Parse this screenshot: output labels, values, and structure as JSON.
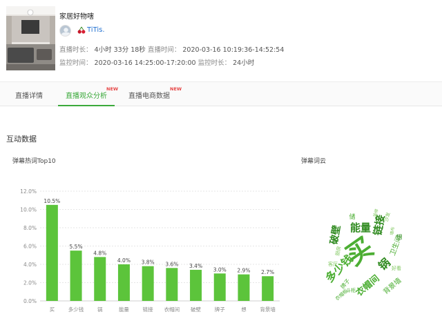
{
  "header": {
    "title": "家居好物嗐",
    "anchor_name": "TiTis.",
    "row1": {
      "duration_label": "直播时长：",
      "duration_value": "4小时 33分 18秒",
      "time_label": "直播时间：",
      "time_value": "2020-03-16 10:19:36-14:52:54"
    },
    "row2": {
      "monitor_time_label": "监控时间：",
      "monitor_time_value": "2020-03-16 14:25:00-17:20:00",
      "monitor_duration_label": "监控时长：",
      "monitor_duration_value": "24小时"
    }
  },
  "tabs": [
    {
      "label": "直播详情",
      "active": false,
      "new": ""
    },
    {
      "label": "直播观众分析",
      "active": true,
      "new": "NEW"
    },
    {
      "label": "直播电商数据",
      "active": false,
      "new": "NEW"
    }
  ],
  "section_title": "互动数据",
  "bar_chart_title": "弹幕热词Top10",
  "cloud_title": "弹幕词云",
  "colors": {
    "accent": "#3aa93a",
    "bar": "#5cc43b",
    "new_badge": "#e64545",
    "cloud_dark": "#2f8a1f",
    "cloud_mid": "#4cae33",
    "cloud_light": "#7cc65a"
  },
  "chart_data": {
    "type": "bar",
    "title": "弹幕热词Top10",
    "categories": [
      "买",
      "多少钱",
      "锅",
      "能量",
      "链接",
      "衣帽间",
      "破壁",
      "牌子",
      "想",
      "背景墙"
    ],
    "values": [
      10.5,
      5.5,
      4.8,
      4.0,
      3.8,
      3.6,
      3.4,
      3.0,
      2.9,
      2.7
    ],
    "value_labels": [
      "10.5%",
      "5.5%",
      "4.8%",
      "4.0%",
      "3.8%",
      "3.6%",
      "3.4%",
      "3.0%",
      "2.9%",
      "2.7%"
    ],
    "y_ticks": [
      "0.0%",
      "2.0%",
      "4.0%",
      "6.0%",
      "8.0%",
      "10.0%",
      "12.0%"
    ],
    "ylim": [
      0,
      12
    ],
    "grid": true,
    "xlabel": "",
    "ylabel": ""
  },
  "word_cloud": [
    {
      "text": "买",
      "weight": 10
    },
    {
      "text": "多少钱",
      "weight": 6
    },
    {
      "text": "锅",
      "weight": 6
    },
    {
      "text": "能量",
      "weight": 5
    },
    {
      "text": "链接",
      "weight": 5
    },
    {
      "text": "衣帽间",
      "weight": 4
    },
    {
      "text": "破壁",
      "weight": 4
    },
    {
      "text": "卫生间",
      "weight": 3
    },
    {
      "text": "背景墙",
      "weight": 3
    },
    {
      "text": "牌子",
      "weight": 2
    },
    {
      "text": "想",
      "weight": 2
    },
    {
      "text": "沙发",
      "weight": 1
    },
    {
      "text": "厨房",
      "weight": 1
    },
    {
      "text": "斗柜",
      "weight": 1
    },
    {
      "text": "衣帽柜",
      "weight": 1
    },
    {
      "text": "客厅",
      "weight": 1
    },
    {
      "text": "好看",
      "weight": 1
    },
    {
      "text": "装修",
      "weight": 1
    },
    {
      "text": "储",
      "weight": 1
    },
    {
      "text": "墙布",
      "weight": 1
    }
  ]
}
